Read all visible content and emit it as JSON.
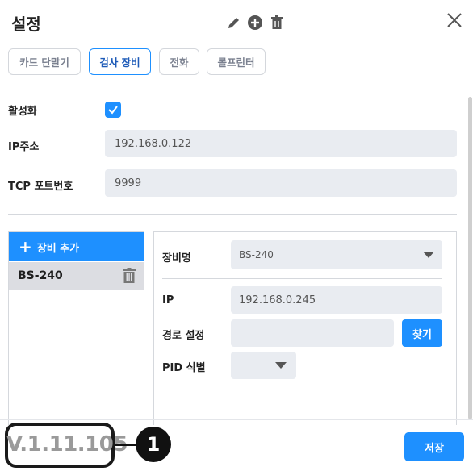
{
  "header": {
    "title": "설정",
    "icons": [
      "pencil-icon",
      "plus-circle-icon",
      "trash-icon"
    ],
    "close_icon": "close-icon"
  },
  "tabs": [
    {
      "label": "카드 단말기",
      "active": false
    },
    {
      "label": "검사 장비",
      "active": true
    },
    {
      "label": "전화",
      "active": false
    },
    {
      "label": "롤프린터",
      "active": false
    }
  ],
  "settings": {
    "enabled_label": "활성화",
    "enabled_checked": true,
    "ip_label": "IP주소",
    "ip_value": "192.168.0.122",
    "port_label": "TCP 포트번호",
    "port_value": "9999"
  },
  "device_list": {
    "add_label": "장비 추가",
    "items": [
      {
        "name": "BS-240"
      }
    ]
  },
  "device_detail": {
    "name_label": "장비명",
    "name_value": "BS-240",
    "ip_label": "IP",
    "ip_value": "192.168.0.245",
    "path_label": "경로 설정",
    "path_value": "",
    "find_label": "찾기",
    "pid_label": "PID 식별",
    "pid_value": ""
  },
  "footer": {
    "version": "V.1.11.105",
    "annotation_number": "1",
    "save_label": "저장"
  },
  "colors": {
    "accent": "#1e90ff",
    "field_bg": "#e9ecf1",
    "selected_row": "#dcdde2"
  }
}
